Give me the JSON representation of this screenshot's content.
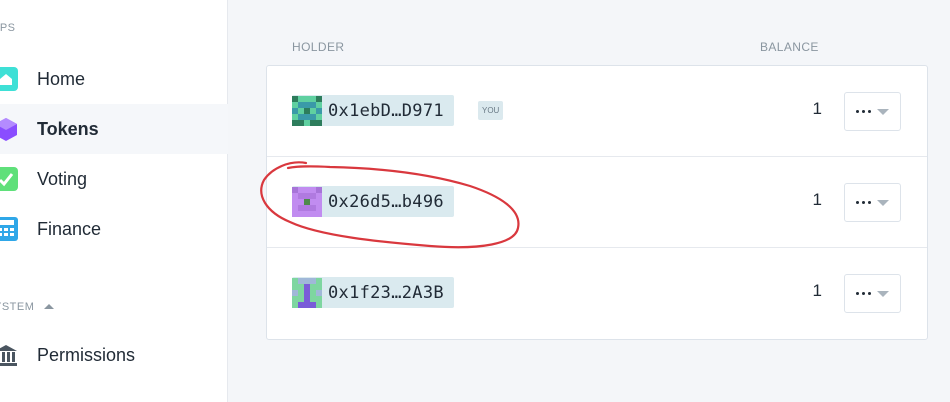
{
  "sidebar": {
    "apps_label": "PPS",
    "system_label": "YSTEM",
    "items": [
      {
        "label": "Home",
        "icon": "home-icon"
      },
      {
        "label": "Tokens",
        "icon": "tokens-icon"
      },
      {
        "label": "Voting",
        "icon": "voting-icon"
      },
      {
        "label": "Finance",
        "icon": "finance-icon"
      },
      {
        "label": "Permissions",
        "icon": "permissions-icon"
      }
    ],
    "active": "Tokens"
  },
  "table": {
    "headers": {
      "holder": "HOLDER",
      "balance": "BALANCE"
    },
    "rows": [
      {
        "address": "0x1ebD…D971",
        "balance": "1",
        "badge": "YOU",
        "identicon_color": "#5fd0a0"
      },
      {
        "address": "0x26d5…b496",
        "balance": "1",
        "badge": "",
        "identicon_color": "#c18cf0"
      },
      {
        "address": "0x1f23…2A3B",
        "balance": "1",
        "badge": "",
        "identicon_color": "#7ed6a0"
      }
    ]
  },
  "colors": {
    "accent": "#daeaef",
    "annotation": "#d9383e"
  }
}
